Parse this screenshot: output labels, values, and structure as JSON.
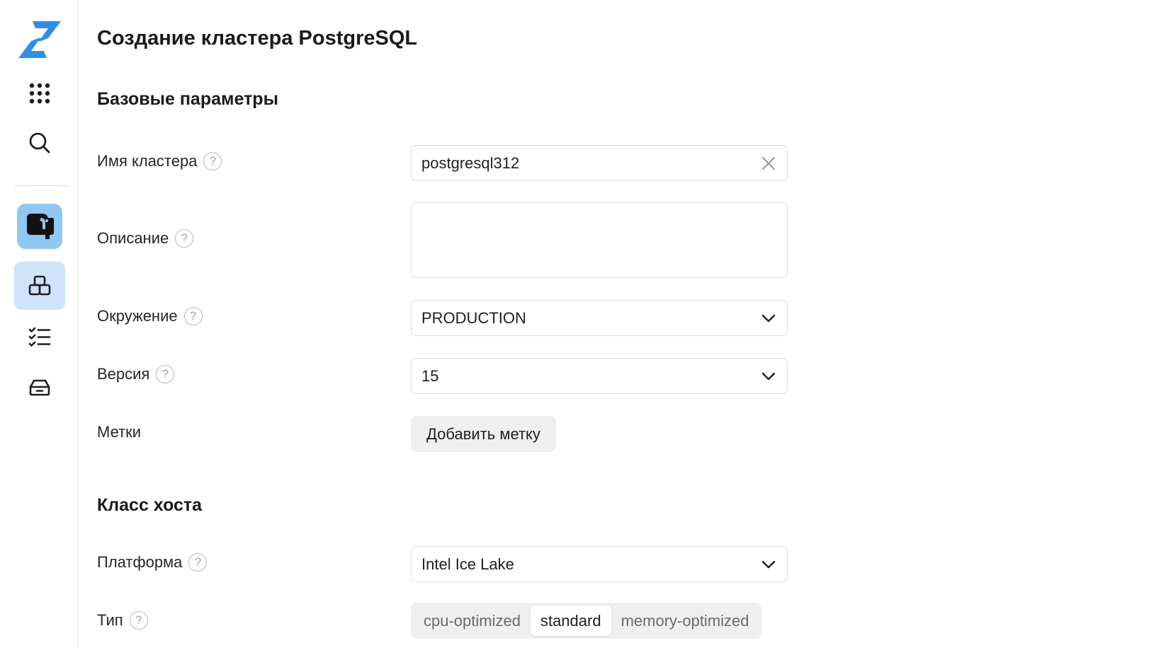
{
  "page": {
    "title": "Создание кластера PostgreSQL"
  },
  "sidebar": {
    "icons": [
      {
        "name": "cloud-logo-icon"
      },
      {
        "name": "apps-grid-icon"
      },
      {
        "name": "search-icon"
      },
      {
        "name": "postgresql-service-icon"
      },
      {
        "name": "clusters-icon",
        "selected": true
      },
      {
        "name": "tasks-list-icon"
      },
      {
        "name": "storage-icon"
      }
    ]
  },
  "sections": {
    "basic": {
      "title": "Базовые параметры",
      "fields": {
        "cluster_name": {
          "label": "Имя кластера",
          "value": "postgresql312"
        },
        "description": {
          "label": "Описание",
          "value": ""
        },
        "environment": {
          "label": "Окружение",
          "value": "PRODUCTION"
        },
        "version": {
          "label": "Версия",
          "value": "15"
        },
        "labels": {
          "label": "Метки",
          "button_label": "Добавить метку"
        }
      }
    },
    "host_class": {
      "title": "Класс хоста",
      "fields": {
        "platform": {
          "label": "Платформа",
          "value": "Intel Ice Lake"
        },
        "type": {
          "label": "Тип",
          "options": [
            "cpu-optimized",
            "standard",
            "memory-optimized"
          ],
          "selected": "standard"
        }
      }
    }
  },
  "help_glyph": "?",
  "colors": {
    "accent": "#2f8fe8",
    "selected_bg": "#cfe4fb",
    "tile_bg": "#8fc7f2"
  }
}
